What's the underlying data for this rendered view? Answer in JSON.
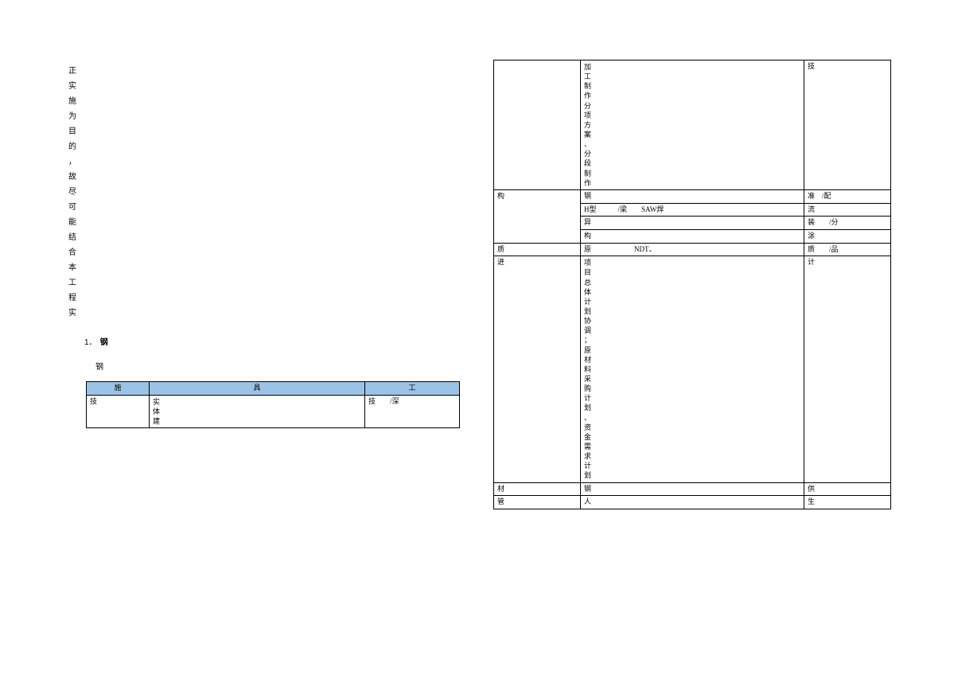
{
  "left_vertical": [
    "正",
    "实",
    "施",
    "为",
    "目",
    "的",
    "，",
    "故",
    "尽",
    "可",
    "能",
    "结",
    "合",
    "本",
    "工",
    "程",
    "实"
  ],
  "heading_num": "1．",
  "heading_text": "钢",
  "subtext": "钢",
  "table1": {
    "headers": [
      "施",
      "具",
      "工"
    ],
    "row1": {
      "c1": "技",
      "c2_lines": [
        "实",
        "体",
        "建"
      ],
      "c3": "技　　/深"
    }
  },
  "table2": {
    "row_prev": {
      "c1": "",
      "c2_lines": [
        "加",
        "工",
        "制",
        "作",
        "分",
        "项",
        "方",
        "案",
        "、",
        "分",
        "段",
        "制",
        "作"
      ],
      "c3": "技"
    },
    "row_gou": {
      "c1": "构",
      "r1": {
        "c2": "钢",
        "c3": "准　/配"
      },
      "r2": {
        "c2": "H型　　　/梁　　SAW焊",
        "c3": "流"
      },
      "r3": {
        "c2": "异",
        "c3": "装　　/分"
      },
      "r4": {
        "c2": "构",
        "c3": "涂"
      }
    },
    "row_zhi": {
      "c1": "质",
      "c2": "原　　　　　　NDT、",
      "c3": "质　　/品"
    },
    "row_jin": {
      "c1": "进",
      "c2_lines": [
        "项",
        "目",
        "总",
        "体",
        "计",
        "划",
        "协",
        "调",
        "；",
        "原",
        "材",
        "料",
        "采",
        "购",
        "计",
        "划",
        "、",
        "资",
        "金",
        "需",
        "求",
        "计",
        "划"
      ],
      "c3": "计"
    },
    "row_cai": {
      "c1": "材",
      "c2": "钢",
      "c3": "供"
    },
    "row_guan": {
      "c1": "管",
      "c2": "人",
      "c3": "生"
    }
  }
}
